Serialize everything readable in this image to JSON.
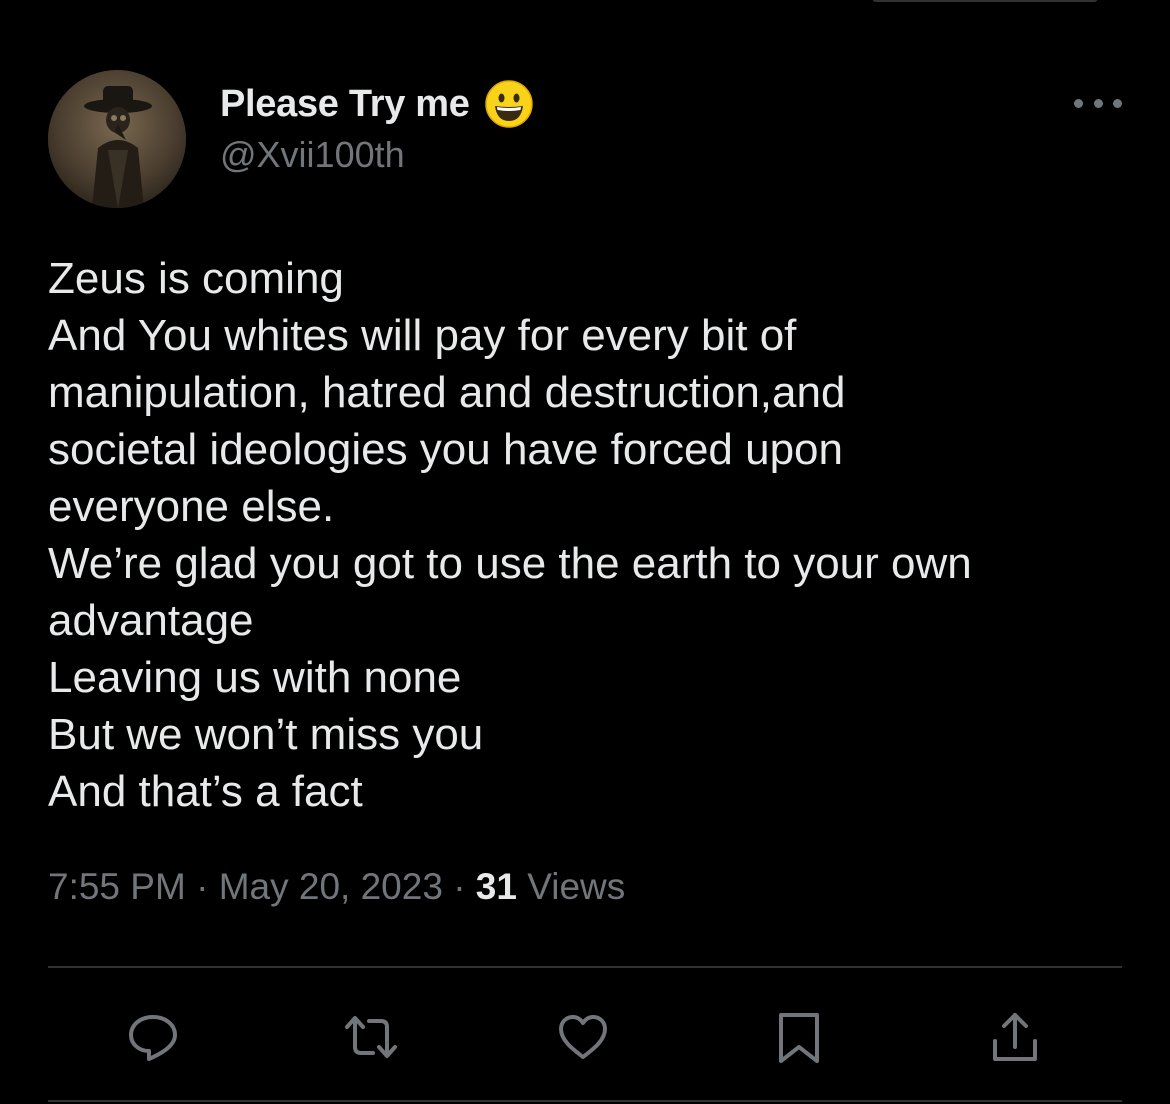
{
  "tweet": {
    "author": {
      "display_name": "Please Try me",
      "handle": "@Xvii100th",
      "name_emoji": "grinning-face-emoji"
    },
    "text_lines": [
      "Zeus is coming",
      "And You whites will pay for every bit of",
      "manipulation, hatred and destruction,and",
      "societal ideologies you have forced upon",
      "everyone else.",
      "We’re glad you got to use the earth to your own",
      "advantage",
      "Leaving us with none",
      "But we won’t miss you",
      "And that’s a fact"
    ],
    "time": "7:55 PM",
    "separator": "·",
    "date": "May 20, 2023",
    "views_count": "31",
    "views_label": "Views"
  },
  "actions": {
    "reply": "reply-icon",
    "retweet": "retweet-icon",
    "like": "heart-icon",
    "bookmark": "bookmark-icon",
    "share": "share-icon"
  },
  "colors": {
    "background": "#000000",
    "primary_text": "#e7e9ea",
    "secondary_text": "#71767b",
    "divider": "#2f3336"
  }
}
